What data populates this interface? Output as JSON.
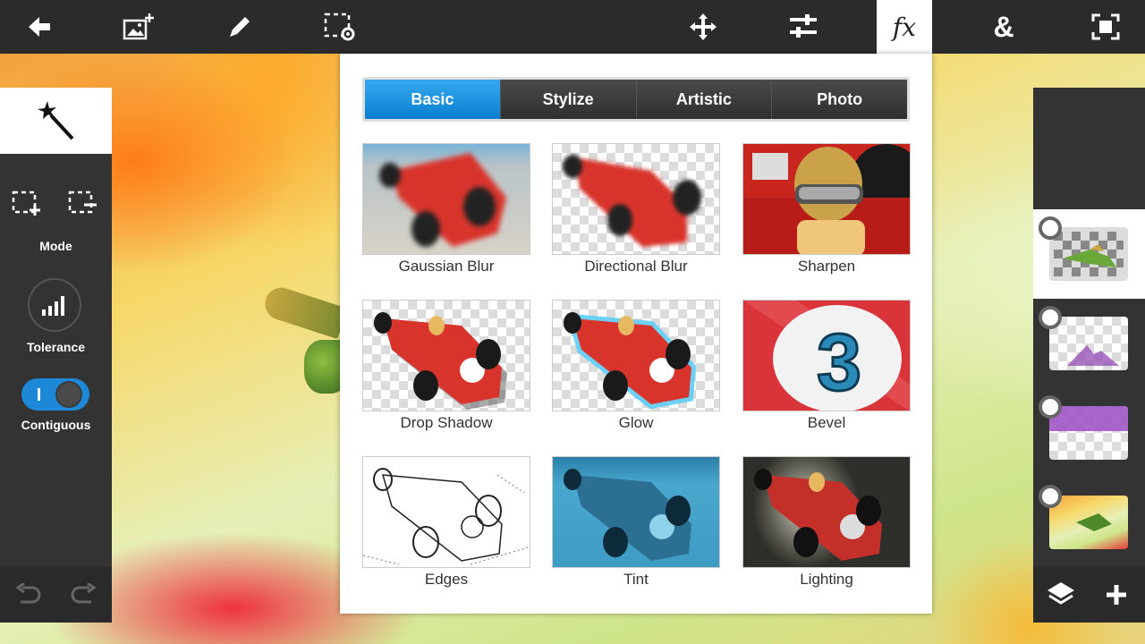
{
  "toolbar": {
    "buttons": [
      {
        "name": "back",
        "icon": "back-arrow-icon"
      },
      {
        "name": "add-image",
        "icon": "add-image-icon"
      },
      {
        "name": "draw",
        "icon": "pencil-icon"
      },
      {
        "name": "selection-settings",
        "icon": "selection-gear-icon"
      },
      {
        "name": "move",
        "icon": "move-arrows-icon"
      },
      {
        "name": "adjustments",
        "icon": "sliders-icon"
      },
      {
        "name": "effects",
        "icon": "fx-icon",
        "label": "fx",
        "active": true
      },
      {
        "name": "text",
        "icon": "ampersand-icon",
        "label": "&"
      },
      {
        "name": "fullscreen",
        "icon": "fullscreen-icon"
      }
    ]
  },
  "left_panel": {
    "tool_icon": "magic-wand-icon",
    "mode_label": "Mode",
    "tolerance_label": "Tolerance",
    "contiguous_label": "Contiguous",
    "contiguous_on": true
  },
  "fx_panel": {
    "tabs": [
      {
        "label": "Basic",
        "active": true
      },
      {
        "label": "Stylize",
        "active": false
      },
      {
        "label": "Artistic",
        "active": false
      },
      {
        "label": "Photo",
        "active": false
      }
    ],
    "effects": [
      {
        "label": "Gaussian Blur"
      },
      {
        "label": "Directional Blur"
      },
      {
        "label": "Sharpen"
      },
      {
        "label": "Drop Shadow"
      },
      {
        "label": "Glow"
      },
      {
        "label": "Bevel"
      },
      {
        "label": "Edges"
      },
      {
        "label": "Tint"
      },
      {
        "label": "Lighting"
      }
    ]
  },
  "layers": [
    {
      "name": "bird-layer",
      "selected": true
    },
    {
      "name": "purple-shape-layer",
      "selected": false
    },
    {
      "name": "purple-fill-layer",
      "selected": false
    },
    {
      "name": "photo-layer",
      "selected": false
    }
  ],
  "colors": {
    "toolbar_bg": "#2b2b2b",
    "panel_bg": "#333333",
    "accent": "#1e88d8",
    "tab_active": "#0a7fd0"
  }
}
